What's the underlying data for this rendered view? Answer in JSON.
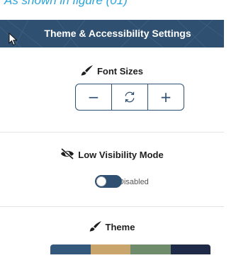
{
  "caption": "As shown in figure (01)",
  "header": {
    "title": "Theme & Accessibility Settings"
  },
  "font_sizes": {
    "title": "Font Sizes",
    "icon": "paintbrush-icon",
    "decrease_label": "−",
    "reset_icon": "reset-icon",
    "increase_label": "+"
  },
  "low_visibility": {
    "title": "Low Visibility Mode",
    "icon": "eye-slash-icon",
    "toggle_state": "Disabled",
    "enabled": false
  },
  "theme": {
    "title": "Theme",
    "icon": "paintbrush-icon",
    "swatches": [
      "#34597d",
      "#c9a46c",
      "#6e8c6c",
      "#1e2a47"
    ]
  },
  "colors": {
    "accent": "#2f5070",
    "caption": "#2aa3d8"
  }
}
